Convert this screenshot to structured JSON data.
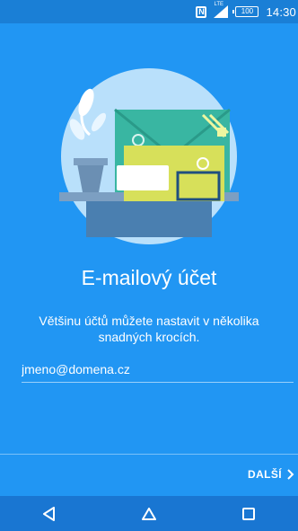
{
  "status_bar": {
    "network_type": "LTE",
    "battery_level": "100",
    "time": "14:30",
    "icons": [
      "nfc-icon",
      "signal-icon",
      "battery-icon"
    ]
  },
  "screen": {
    "title": "E-mailový účet",
    "subtitle": "Většinu účtů můžete nastavit v několika snadných krocích.",
    "email_input": {
      "value": "jmeno@domena.cz",
      "placeholder": ""
    },
    "next_button": {
      "label": "DALŠÍ",
      "icon": "chevron-right-icon"
    }
  },
  "nav_bar": {
    "items": [
      "back-icon",
      "home-icon",
      "recents-icon"
    ]
  },
  "colors": {
    "background": "#2196f3",
    "status_bar": "#1a7fd6",
    "nav_bar": "#1976d2",
    "illustration_circle": "#b9e0fb",
    "envelope_green": "#39b6a2",
    "card_yellow": "#d7e05a"
  }
}
